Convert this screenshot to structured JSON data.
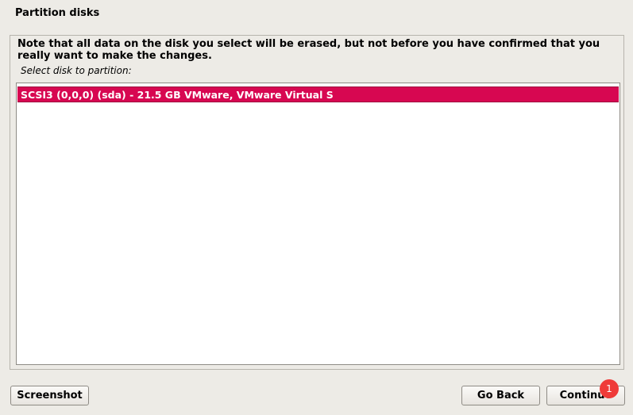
{
  "page": {
    "title": "Partition disks"
  },
  "main": {
    "note": "Note that all data on the disk you select will be erased, but not before you have confirmed that you really want to make the changes.",
    "select_label": "Select disk to partition:",
    "disks": [
      {
        "label": "SCSI3 (0,0,0) (sda) - 21.5 GB VMware, VMware Virtual S",
        "selected": true
      }
    ],
    "selection_color": "#d70751"
  },
  "buttons": {
    "screenshot": "Screenshot",
    "go_back": "Go Back",
    "continue": "Continue"
  },
  "badge": {
    "count": "1",
    "color": "#ef3b39"
  }
}
